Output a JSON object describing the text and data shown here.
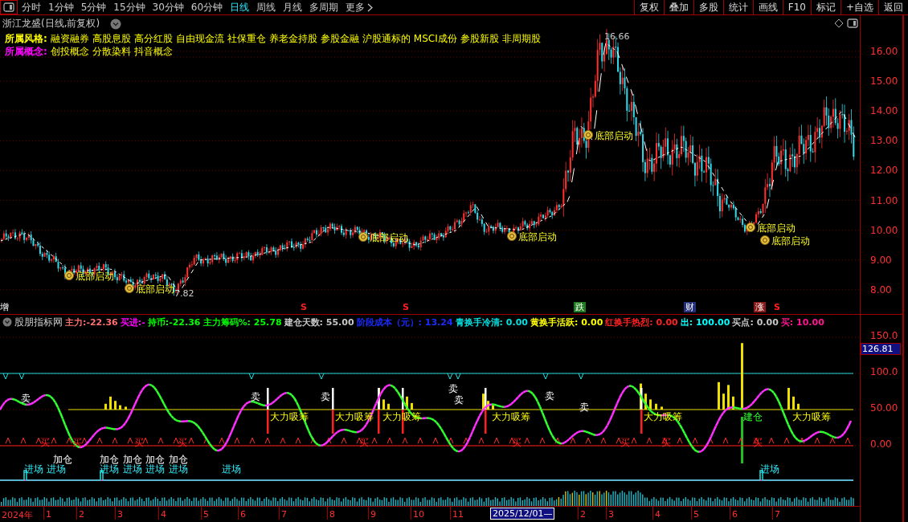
{
  "toolbar": {
    "periods": [
      {
        "label": "分时",
        "selected": false
      },
      {
        "label": "1分钟",
        "selected": false
      },
      {
        "label": "5分钟",
        "selected": false
      },
      {
        "label": "15分钟",
        "selected": false
      },
      {
        "label": "30分钟",
        "selected": false
      },
      {
        "label": "60分钟",
        "selected": false
      },
      {
        "label": "日线",
        "selected": true
      },
      {
        "label": "周线",
        "selected": false
      },
      {
        "label": "月线",
        "selected": false
      },
      {
        "label": "多周期",
        "selected": false
      },
      {
        "label": "更多",
        "selected": false
      }
    ],
    "actions": [
      "复权",
      "叠加",
      "多股",
      "统计",
      "画线",
      "F10",
      "标记",
      "+自选",
      "返回"
    ]
  },
  "stock_title": "浙江龙盛(日线,前复权)",
  "info_rows": [
    {
      "label": "所属风格:",
      "color": "#ffff00",
      "items": [
        "融资融券",
        "高股息股",
        "高分红股",
        "自由现金流",
        "社保重仓",
        "养老金持股",
        "参股金融",
        "沪股通标的",
        "MSCI成份",
        "参股新股",
        "非周期股"
      ]
    },
    {
      "label": "所属概念:",
      "color": "#ff00ff",
      "items": [
        "创投概念",
        "分散染料",
        "抖音概念"
      ]
    }
  ],
  "price_chart": {
    "high_label": "16.66",
    "low_label": "7.82",
    "signals": [
      "底部启动",
      "底部启动",
      "底部启动",
      "底部启动",
      "底部启动",
      "底部启动",
      "底部启动"
    ],
    "events": [
      {
        "text": "增",
        "kind": "plain"
      },
      {
        "text": "S",
        "kind": "letter"
      },
      {
        "text": "S",
        "kind": "letter"
      },
      {
        "text": "跌",
        "kind": "box",
        "color": "#1f7a1f"
      },
      {
        "text": "财",
        "kind": "box",
        "color": "#24307a"
      },
      {
        "text": "涨",
        "kind": "box",
        "color": "#8a1a1a"
      },
      {
        "text": "S",
        "kind": "letter"
      }
    ]
  },
  "price_axis": [
    "16.00",
    "15.00",
    "14.00",
    "13.00",
    "12.00",
    "11.00",
    "10.00",
    "9.00",
    "8.00"
  ],
  "indicator": {
    "name": "股朋指标网",
    "readouts": [
      {
        "text": "主力:-22.36",
        "color": "#ff7070"
      },
      {
        "text": "买进:-",
        "color": "#ff00ff"
      },
      {
        "text": "持币:-22.36",
        "color": "#00ff00"
      },
      {
        "text": "主力筹码%: 25.78",
        "color": "#00ff00"
      },
      {
        "text": "建仓天数: 55.00",
        "color": "#c8c8c8"
      },
      {
        "text": "阶段成本（元）: 13.24",
        "color": "#1a2cff"
      },
      {
        "text": "青换手冷清: 0.00",
        "color": "#00e0e0"
      },
      {
        "text": "黄换手活跃: 0.00",
        "color": "#ffff00"
      },
      {
        "text": "红换手热烈: 0.00",
        "color": "#ff2020"
      },
      {
        "text": "出: 100.00",
        "color": "#00ffff"
      },
      {
        "text": "买点: 0.00",
        "color": "#c8c8c8"
      },
      {
        "text": "买: 10.00",
        "color": "#ff1493"
      }
    ],
    "axis": [
      "150.0",
      "100.0",
      "50.00",
      "0.00"
    ],
    "cursor_value": "126.81",
    "labels": [
      {
        "text": "卖",
        "kind": "sell"
      },
      {
        "text": "卖",
        "kind": "sell"
      },
      {
        "text": "卖",
        "kind": "sell"
      },
      {
        "text": "卖",
        "kind": "sell"
      },
      {
        "text": "卖",
        "kind": "sell"
      },
      {
        "text": "卖",
        "kind": "sell"
      },
      {
        "text": "卖",
        "kind": "sell"
      },
      {
        "text": "大力吸筹",
        "kind": "absorb"
      },
      {
        "text": "大力吸筹",
        "kind": "absorb"
      },
      {
        "text": "大力吸筹",
        "kind": "absorb"
      },
      {
        "text": "大力吸筹",
        "kind": "absorb"
      },
      {
        "text": "大力吸筹",
        "kind": "absorb"
      },
      {
        "text": "大力吸筹",
        "kind": "absorb"
      },
      {
        "text": "买",
        "kind": "buy"
      },
      {
        "text": "买",
        "kind": "buy"
      },
      {
        "text": "买",
        "kind": "buy"
      },
      {
        "text": "买",
        "kind": "buy"
      },
      {
        "text": "买",
        "kind": "buy"
      },
      {
        "text": "买",
        "kind": "buy"
      },
      {
        "text": "买",
        "kind": "buy"
      },
      {
        "text": "买",
        "kind": "buy"
      },
      {
        "text": "买",
        "kind": "buy"
      },
      {
        "text": "加仓",
        "kind": "add"
      },
      {
        "text": "加仓",
        "kind": "add"
      },
      {
        "text": "加仓",
        "kind": "add"
      },
      {
        "text": "加仓",
        "kind": "add"
      },
      {
        "text": "加仓",
        "kind": "add"
      },
      {
        "text": "进场",
        "kind": "enter"
      },
      {
        "text": "进场",
        "kind": "enter"
      },
      {
        "text": "进场",
        "kind": "enter"
      },
      {
        "text": "进场",
        "kind": "enter"
      },
      {
        "text": "进场",
        "kind": "enter"
      },
      {
        "text": "进场",
        "kind": "enter"
      },
      {
        "text": "进场",
        "kind": "enter"
      },
      {
        "text": "进场",
        "kind": "enter"
      },
      {
        "text": "建仓",
        "kind": "build"
      }
    ]
  },
  "date_axis": [
    {
      "text": "2024年",
      "selected": false
    },
    {
      "text": "1",
      "selected": false
    },
    {
      "text": "2",
      "selected": false
    },
    {
      "text": "3",
      "selected": false
    },
    {
      "text": "4",
      "selected": false
    },
    {
      "text": "5",
      "selected": false
    },
    {
      "text": "6",
      "selected": false
    },
    {
      "text": "7",
      "selected": false
    },
    {
      "text": "8",
      "selected": false
    },
    {
      "text": "9",
      "selected": false
    },
    {
      "text": "10",
      "selected": false
    },
    {
      "text": "11",
      "selected": false
    },
    {
      "text": "2025/12/01—",
      "selected": true
    },
    {
      "text": "2",
      "selected": false
    },
    {
      "text": "3",
      "selected": false
    },
    {
      "text": "4",
      "selected": false
    },
    {
      "text": "5",
      "selected": false
    },
    {
      "text": "6",
      "selected": false
    },
    {
      "text": "7",
      "selected": false
    }
  ]
}
